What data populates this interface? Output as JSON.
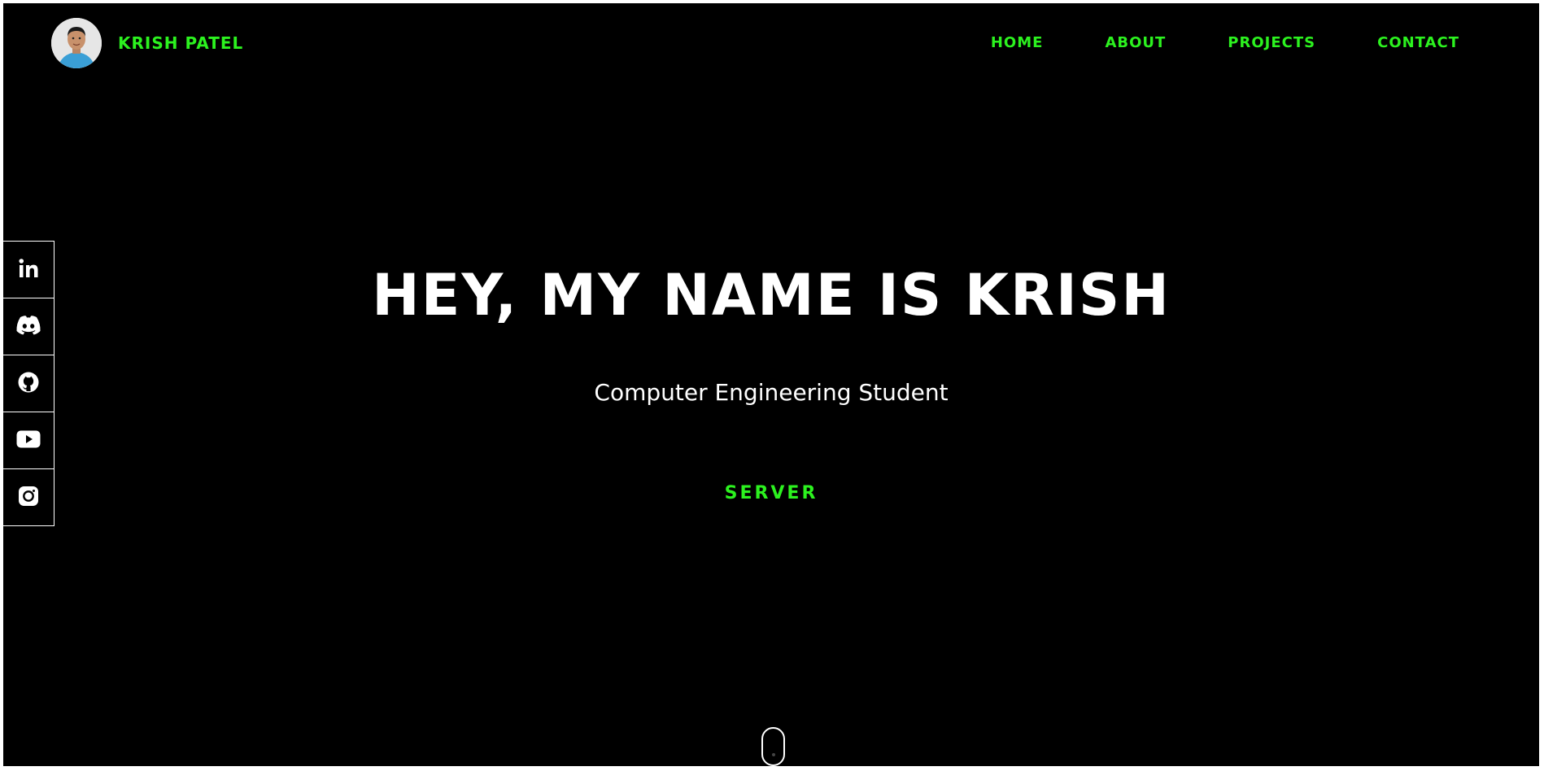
{
  "header": {
    "brand_name": "KRISH PATEL",
    "nav": [
      {
        "label": "HOME"
      },
      {
        "label": "ABOUT"
      },
      {
        "label": "PROJECTS"
      },
      {
        "label": "CONTACT"
      }
    ]
  },
  "social": [
    {
      "icon": "linkedin-icon"
    },
    {
      "icon": "discord-icon"
    },
    {
      "icon": "github-icon"
    },
    {
      "icon": "youtube-icon"
    },
    {
      "icon": "instagram-icon"
    }
  ],
  "hero": {
    "title": "HEY, MY NAME IS KRISH",
    "subtitle": "Computer Engineering Student",
    "button_label": "SERVER"
  },
  "colors": {
    "accent": "#2cf21f",
    "background": "#000000",
    "text": "#ffffff"
  }
}
